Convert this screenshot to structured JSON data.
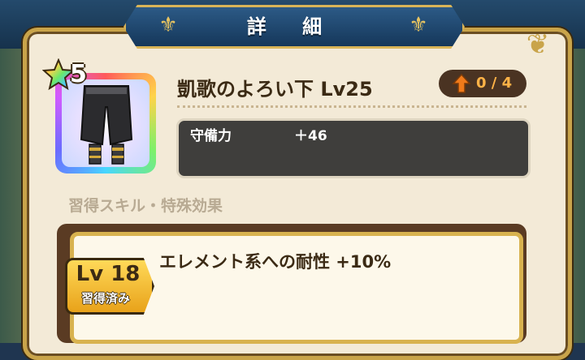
{
  "header": {
    "title": "詳 細"
  },
  "item": {
    "rarity_stars": "5",
    "name": "凱歌のよろい下 Lv25",
    "upgrade_count": "0 / 4"
  },
  "stats": [
    {
      "label": "守備力",
      "value": "＋46"
    }
  ],
  "skills_section": {
    "label": "習得スキル・特殊効果"
  },
  "skills": [
    {
      "level": "Lv 18",
      "status": "習得済み",
      "effect": "エレメント系への耐性 +10%"
    }
  ],
  "colors": {
    "gold": "#c9a44a",
    "panel": "#f3ead7",
    "title_blue": "#15375a",
    "stat_box": "#3f3e3c",
    "count_orange": "#ffb347"
  },
  "icons": {
    "rarity": "rainbow-star-icon",
    "upgrade": "up-arrow-icon",
    "header_left": "fleur-de-lis-icon",
    "header_right": "fleur-de-lis-icon",
    "item": "armor-leggings-icon"
  }
}
